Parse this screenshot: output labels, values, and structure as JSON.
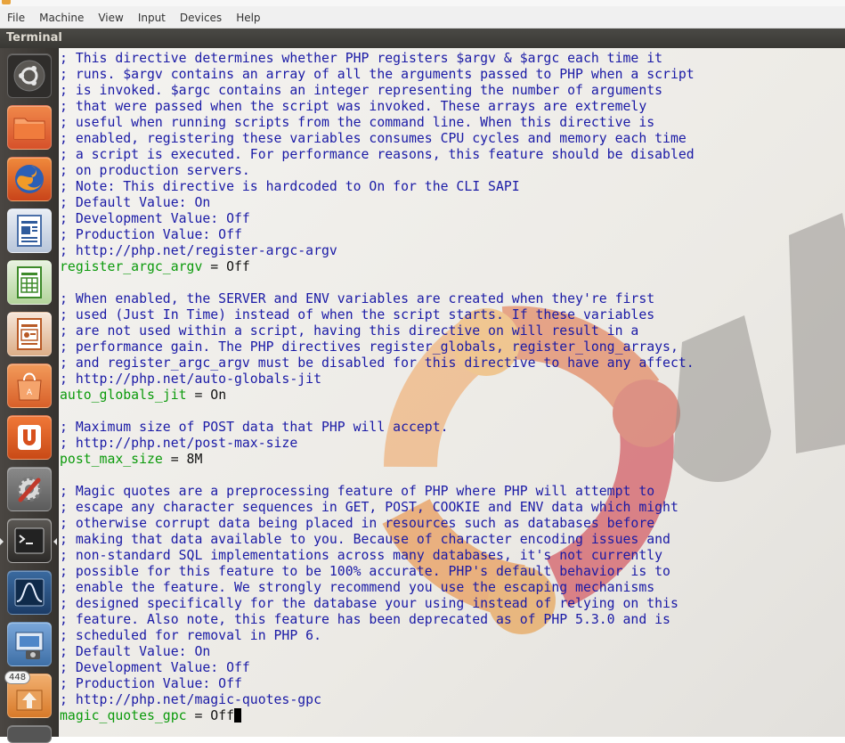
{
  "menubar": {
    "items": [
      "File",
      "Machine",
      "View",
      "Input",
      "Devices",
      "Help"
    ]
  },
  "panel": {
    "title": "Terminal"
  },
  "launcher": {
    "items": [
      {
        "name": "dash-home",
        "icon": "ubuntu-logo-icon"
      },
      {
        "name": "files",
        "icon": "folder-icon"
      },
      {
        "name": "firefox",
        "icon": "firefox-icon"
      },
      {
        "name": "libreoffice-writer",
        "icon": "writer-document-icon"
      },
      {
        "name": "libreoffice-calc",
        "icon": "calc-spreadsheet-icon"
      },
      {
        "name": "libreoffice-impress",
        "icon": "impress-presentation-icon"
      },
      {
        "name": "software-center",
        "icon": "shopping-bag-icon"
      },
      {
        "name": "ubuntu-one",
        "icon": "ubuntu-one-icon"
      },
      {
        "name": "system-settings",
        "icon": "settings-gear-icon"
      },
      {
        "name": "terminal",
        "icon": "terminal-icon"
      },
      {
        "name": "system-monitor",
        "icon": "system-monitor-icon"
      },
      {
        "name": "screenshot",
        "icon": "camera-icon"
      },
      {
        "name": "update-manager",
        "icon": "update-arrow-icon",
        "badge": "448"
      }
    ]
  },
  "terminal": {
    "lines": [
      {
        "type": "comment",
        "text": "; This directive determines whether PHP registers $argv & $argc each time it"
      },
      {
        "type": "comment",
        "text": "; runs. $argv contains an array of all the arguments passed to PHP when a script"
      },
      {
        "type": "comment",
        "text": "; is invoked. $argc contains an integer representing the number of arguments"
      },
      {
        "type": "comment",
        "text": "; that were passed when the script was invoked. These arrays are extremely"
      },
      {
        "type": "comment",
        "text": "; useful when running scripts from the command line. When this directive is"
      },
      {
        "type": "comment",
        "text": "; enabled, registering these variables consumes CPU cycles and memory each time"
      },
      {
        "type": "comment",
        "text": "; a script is executed. For performance reasons, this feature should be disabled"
      },
      {
        "type": "comment",
        "text": "; on production servers."
      },
      {
        "type": "comment",
        "text": "; Note: This directive is hardcoded to On for the CLI SAPI"
      },
      {
        "type": "comment",
        "text": "; Default Value: On"
      },
      {
        "type": "comment",
        "text": "; Development Value: Off"
      },
      {
        "type": "comment",
        "text": "; Production Value: Off"
      },
      {
        "type": "comment",
        "text": "; http://php.net/register-argc-argv"
      },
      {
        "type": "setting",
        "key": "register_argc_argv",
        "eq": " = ",
        "value": "Off"
      },
      {
        "type": "blank",
        "text": ""
      },
      {
        "type": "comment",
        "text": "; When enabled, the SERVER and ENV variables are created when they're first"
      },
      {
        "type": "comment",
        "text": "; used (Just In Time) instead of when the script starts. If these variables"
      },
      {
        "type": "comment",
        "text": "; are not used within a script, having this directive on will result in a"
      },
      {
        "type": "comment",
        "text": "; performance gain. The PHP directives register_globals, register_long_arrays,"
      },
      {
        "type": "comment",
        "text": "; and register_argc_argv must be disabled for this directive to have any affect."
      },
      {
        "type": "comment",
        "text": "; http://php.net/auto-globals-jit"
      },
      {
        "type": "setting",
        "key": "auto_globals_jit",
        "eq": " = ",
        "value": "On"
      },
      {
        "type": "blank",
        "text": ""
      },
      {
        "type": "comment",
        "text": "; Maximum size of POST data that PHP will accept."
      },
      {
        "type": "comment",
        "text": "; http://php.net/post-max-size"
      },
      {
        "type": "setting",
        "key": "post_max_size",
        "eq": " = ",
        "value": "8M"
      },
      {
        "type": "blank",
        "text": ""
      },
      {
        "type": "comment",
        "text": "; Magic quotes are a preprocessing feature of PHP where PHP will attempt to"
      },
      {
        "type": "comment",
        "text": "; escape any character sequences in GET, POST, COOKIE and ENV data which might"
      },
      {
        "type": "comment",
        "text": "; otherwise corrupt data being placed in resources such as databases before"
      },
      {
        "type": "comment",
        "text": "; making that data available to you. Because of character encoding issues and"
      },
      {
        "type": "comment",
        "text": "; non-standard SQL implementations across many databases, it's not currently"
      },
      {
        "type": "comment",
        "text": "; possible for this feature to be 100% accurate. PHP's default behavior is to"
      },
      {
        "type": "comment",
        "text": "; enable the feature. We strongly recommend you use the escaping mechanisms"
      },
      {
        "type": "comment",
        "text": "; designed specifically for the database your using instead of relying on this"
      },
      {
        "type": "comment",
        "text": "; feature. Also note, this feature has been deprecated as of PHP 5.3.0 and is"
      },
      {
        "type": "comment",
        "text": "; scheduled for removal in PHP 6."
      },
      {
        "type": "comment",
        "text": "; Default Value: On"
      },
      {
        "type": "comment",
        "text": "; Development Value: Off"
      },
      {
        "type": "comment",
        "text": "; Production Value: Off"
      },
      {
        "type": "comment",
        "text": "; http://php.net/magic-quotes-gpc"
      },
      {
        "type": "setting",
        "key": "magic_quotes_gpc",
        "eq": " = ",
        "value": "Off",
        "cursor": true
      }
    ]
  },
  "colors": {
    "comment": "#1a1aa6",
    "key": "#0b9a0b",
    "value": "#111111",
    "panel": "#3c3b37",
    "launcher": "#3f3d3a"
  }
}
